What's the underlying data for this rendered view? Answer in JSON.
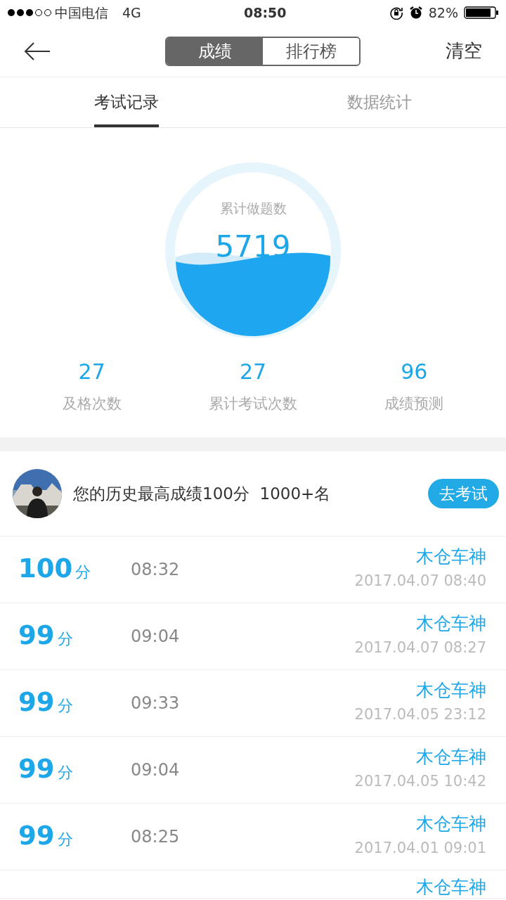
{
  "status_bar": {
    "carrier": "中国电信",
    "network": "4G",
    "time": "08:50",
    "battery": "82%"
  },
  "header": {
    "segments": [
      {
        "label": "成绩",
        "selected": true
      },
      {
        "label": "排行榜",
        "selected": false
      }
    ],
    "action": "清空"
  },
  "tabs": [
    {
      "label": "考试记录",
      "selected": true
    },
    {
      "label": "数据统计",
      "selected": false
    }
  ],
  "gauge": {
    "label": "累计做题数",
    "value": "5719"
  },
  "stats": [
    {
      "value": "27",
      "label": "及格次数"
    },
    {
      "value": "27",
      "label": "累计考试次数"
    },
    {
      "value": "96",
      "label": "成绩预测"
    }
  ],
  "best": {
    "message": "您的历史最高成绩100分  1000+名",
    "button": "去考试"
  },
  "records": [
    {
      "score": "100",
      "unit": "分",
      "duration": "08:32",
      "name": "木仓车神",
      "date": "2017.04.07 08:40"
    },
    {
      "score": "99",
      "unit": "分",
      "duration": "09:04",
      "name": "木仓车神",
      "date": "2017.04.07 08:27"
    },
    {
      "score": "99",
      "unit": "分",
      "duration": "09:33",
      "name": "木仓车神",
      "date": "2017.04.05 23:12"
    },
    {
      "score": "99",
      "unit": "分",
      "duration": "09:04",
      "name": "木仓车神",
      "date": "2017.04.05 10:42"
    },
    {
      "score": "99",
      "unit": "分",
      "duration": "08:25",
      "name": "木仓车神",
      "date": "2017.04.01 09:01"
    },
    {
      "name": "木仓车神"
    }
  ]
}
